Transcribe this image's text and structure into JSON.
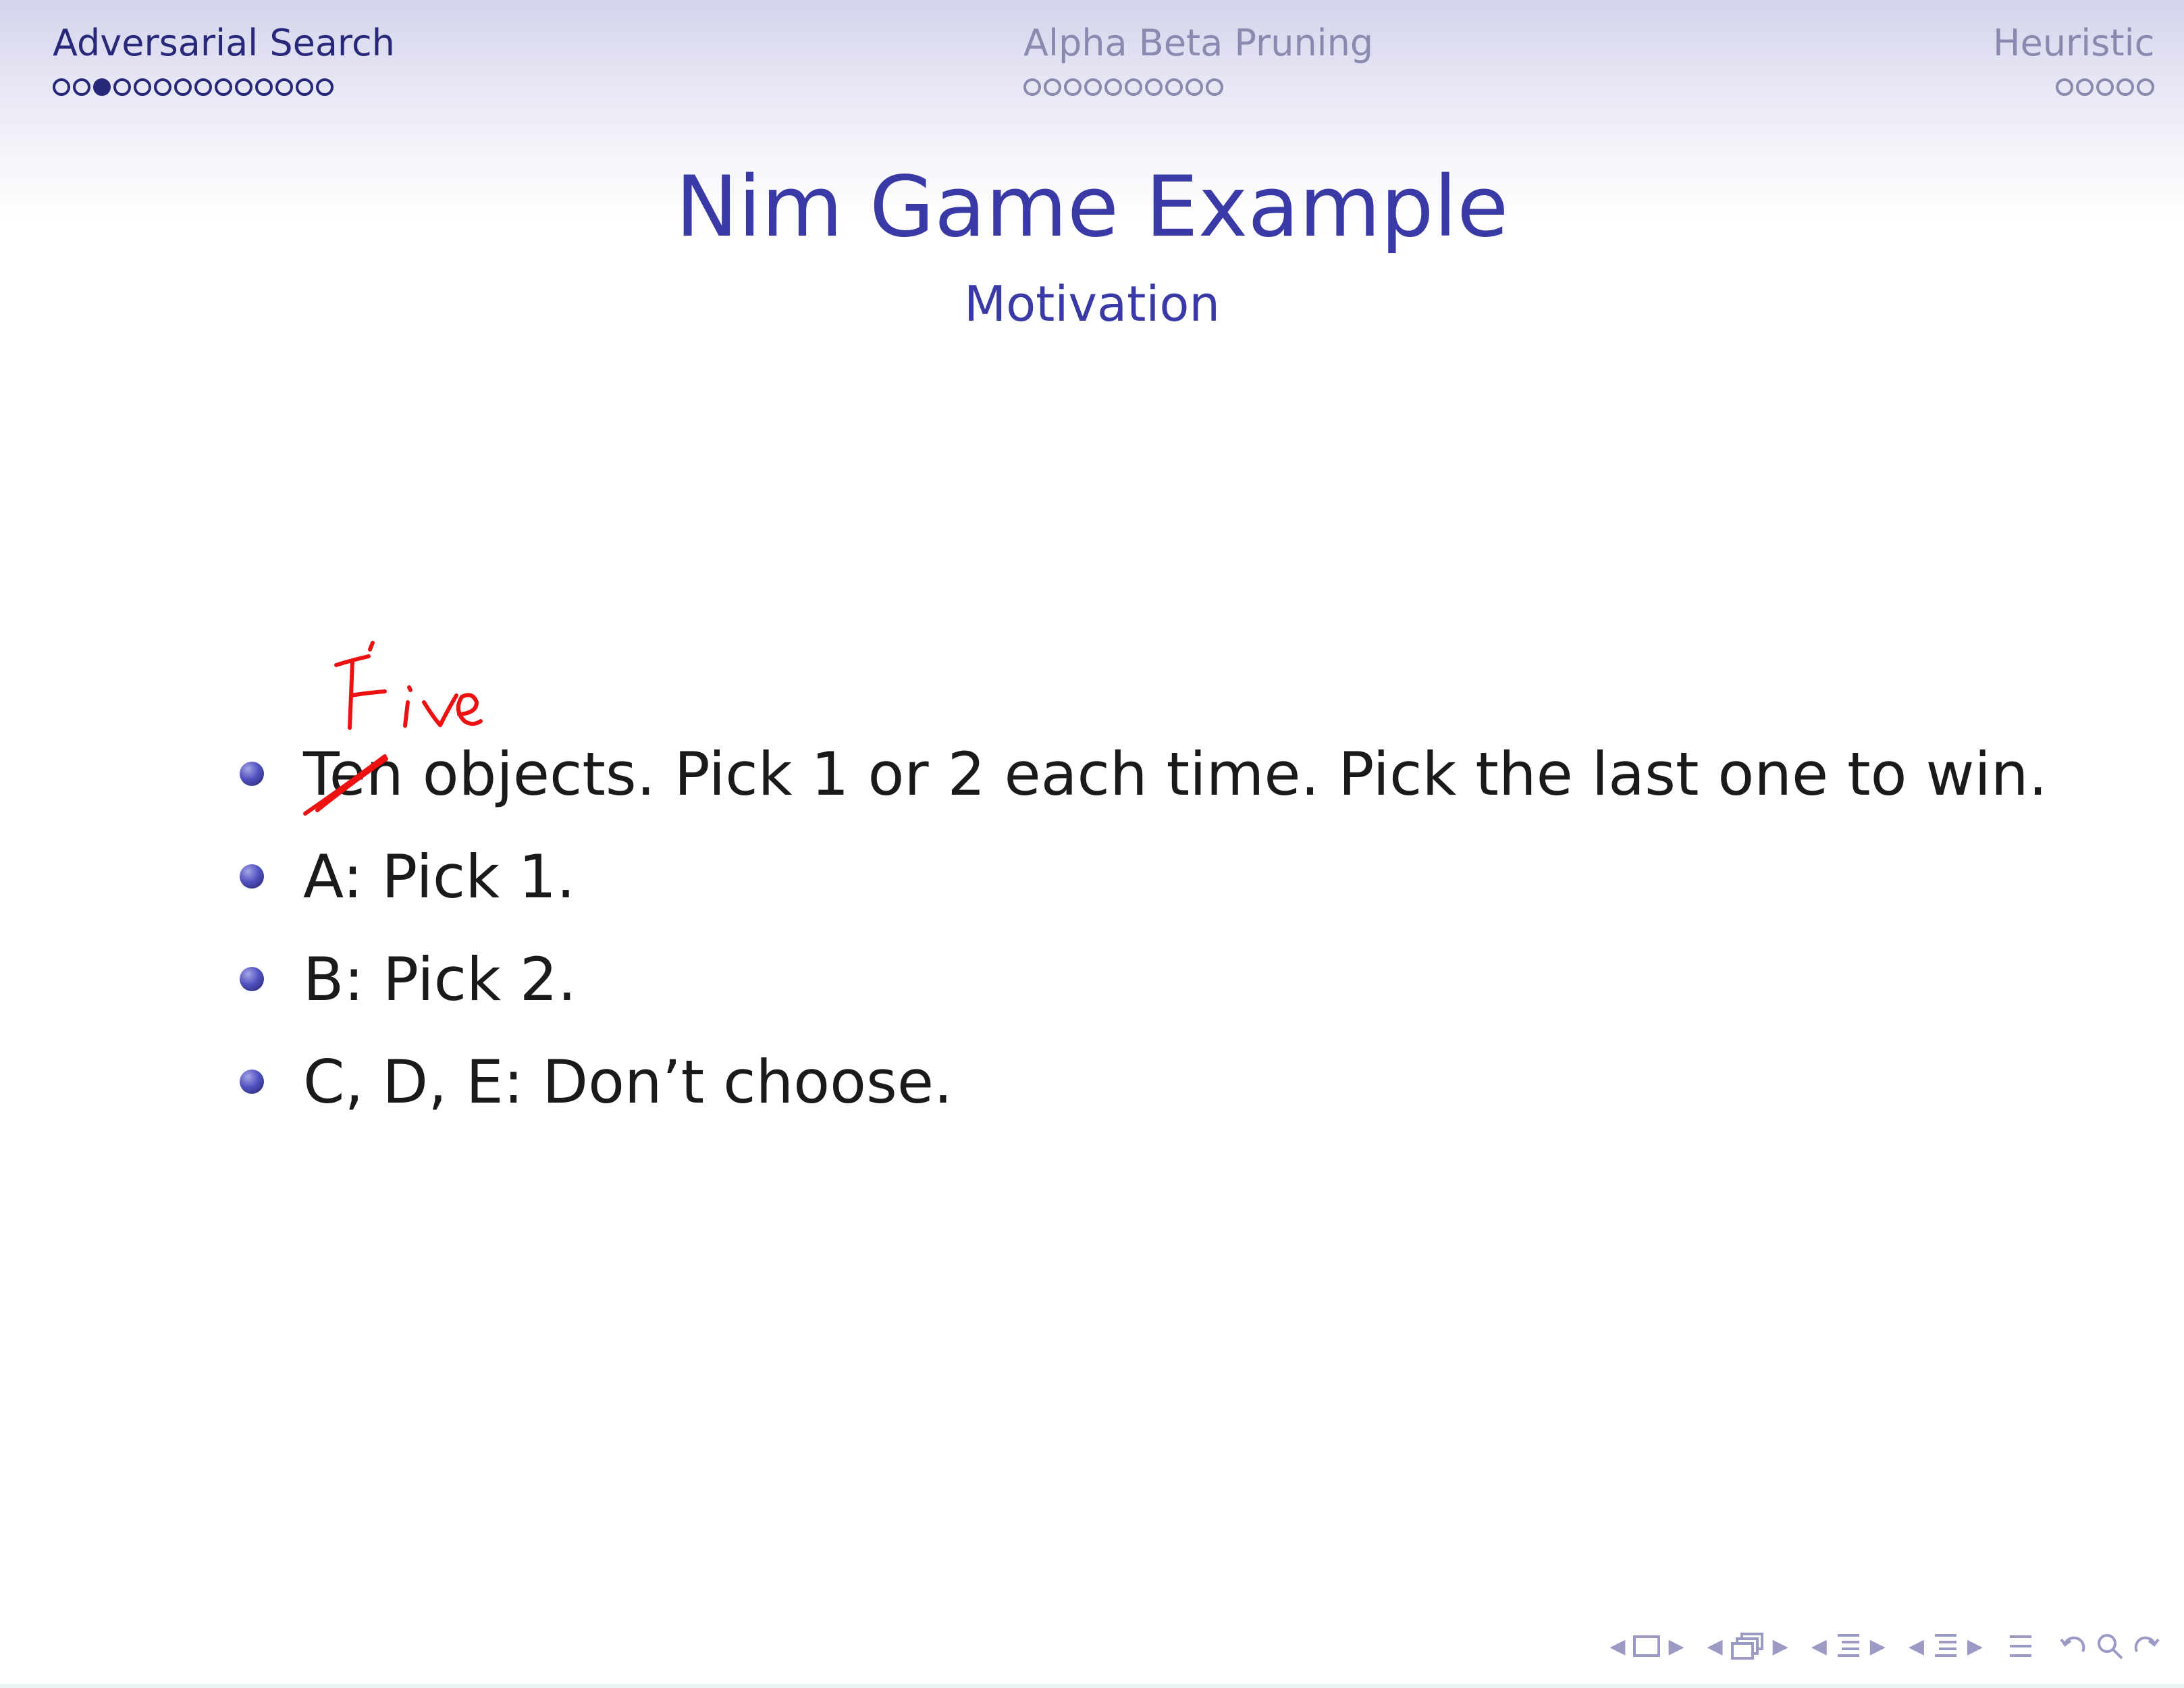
{
  "header": {
    "sections": [
      {
        "label": "Adversarial Search",
        "dots": 14,
        "current": 3,
        "active": true
      },
      {
        "label": "Alpha Beta Pruning",
        "dots": 10,
        "current": 0,
        "active": false
      },
      {
        "label": "Heuristic",
        "dots": 5,
        "current": 0,
        "active": false
      }
    ]
  },
  "frame": {
    "title": "Nim Game Example",
    "subtitle": "Motivation"
  },
  "bullets": [
    "Ten objects.  Pick 1 or 2 each time.  Pick the last one to win.",
    "A: Pick 1.",
    "B: Pick 2.",
    "C, D, E: Don’t choose."
  ],
  "annotation": {
    "text": "Five",
    "color": "#ee1111",
    "strikes_word": "Ten"
  },
  "colors": {
    "accent": "#3a3aa6",
    "header_active": "#28287a",
    "header_inactive": "#8a8ab0",
    "nav": "#9a9ac4"
  },
  "navigation": {
    "icons": [
      "frame-nav-icon",
      "subsection-nav-icon",
      "section-nav-icon",
      "subsubsection-nav-icon",
      "appendix-icon",
      "search-icon"
    ]
  }
}
